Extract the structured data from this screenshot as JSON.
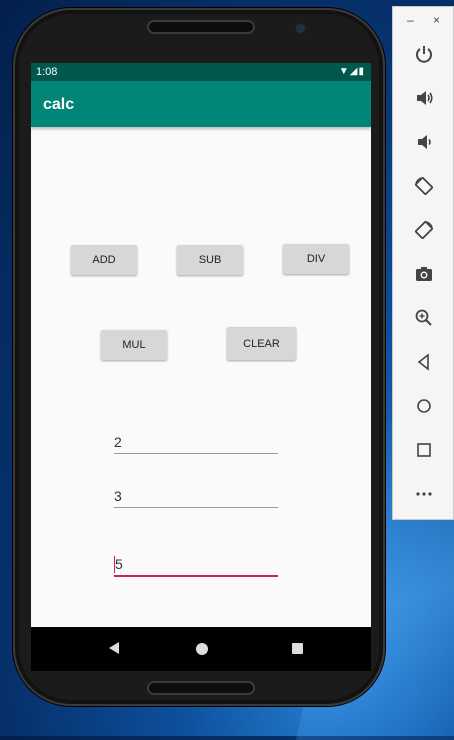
{
  "status_bar": {
    "time": "1:08",
    "icons": "▼◢▮"
  },
  "app": {
    "title": "calc"
  },
  "buttons": {
    "add": "ADD",
    "sub": "SUB",
    "div": "DIV",
    "mul": "MUL",
    "clear": "CLEAR"
  },
  "fields": {
    "first": "2",
    "second": "3",
    "result": "5"
  },
  "toolbar": {
    "minimize": "–",
    "close": "×",
    "items": [
      "power-icon",
      "volume-up-icon",
      "volume-down-icon",
      "rotate-left-icon",
      "rotate-right-icon",
      "camera-icon",
      "zoom-icon",
      "back-icon",
      "home-icon",
      "overview-icon",
      "more-icon"
    ]
  },
  "colors": {
    "primary": "#008577",
    "primary_dark": "#00574b",
    "accent": "#d81b60"
  }
}
